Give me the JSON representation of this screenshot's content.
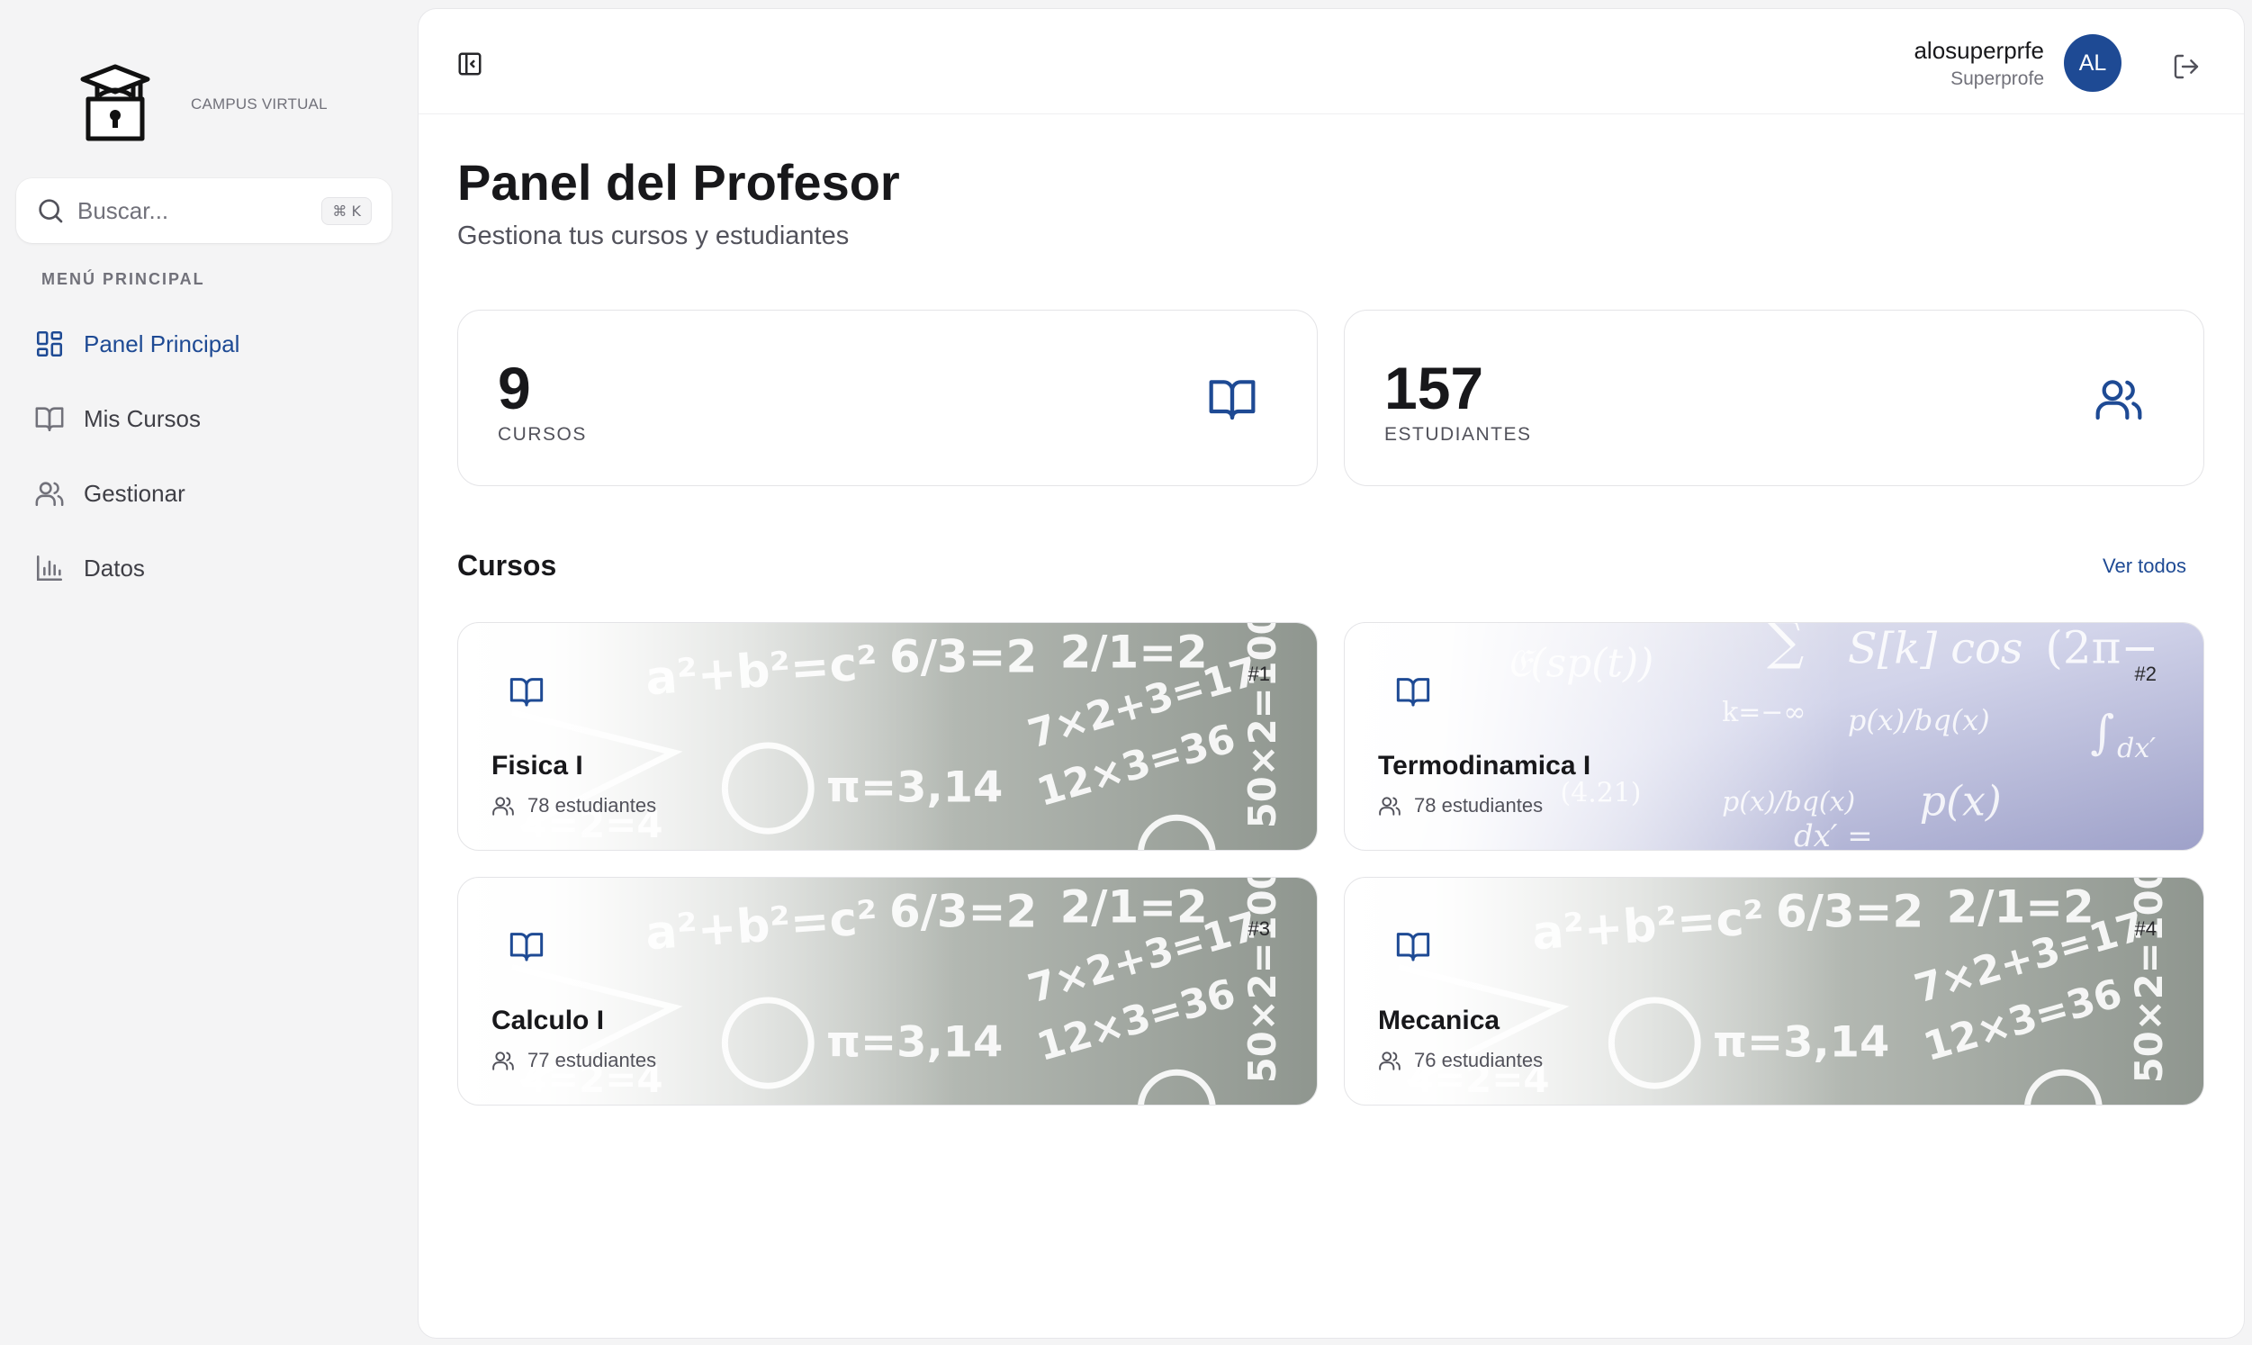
{
  "brand": {
    "name": "CAMPUS VIRTUAL",
    "logo_icon": "graduation-lock-icon"
  },
  "search": {
    "placeholder": "Buscar...",
    "shortcut": "⌘ K"
  },
  "sidebar": {
    "section_title": "MENÚ PRINCIPAL",
    "items": [
      {
        "label": "Panel Principal",
        "icon": "dashboard-icon",
        "active": true
      },
      {
        "label": "Mis Cursos",
        "icon": "book-icon",
        "active": false
      },
      {
        "label": "Gestionar",
        "icon": "users-icon",
        "active": false
      },
      {
        "label": "Datos",
        "icon": "bar-chart-icon",
        "active": false
      }
    ]
  },
  "user": {
    "name": "alosuperprfe",
    "role": "Superprofe",
    "initials": "AL"
  },
  "header": {
    "title": "Panel del Profesor",
    "subtitle": "Gestiona tus cursos y estudiantes"
  },
  "stats": [
    {
      "value": "9",
      "label": "CURSOS",
      "icon": "book-icon"
    },
    {
      "value": "157",
      "label": "ESTUDIANTES",
      "icon": "users-icon"
    }
  ],
  "courses_section": {
    "title": "Cursos",
    "see_all": "Ver todos"
  },
  "courses": [
    {
      "index": "#1",
      "title": "Fisica I",
      "students": "78 estudiantes",
      "background": "chalkboard-math"
    },
    {
      "index": "#2",
      "title": "Termodinamica I",
      "students": "78 estudiantes",
      "background": "formula-violet"
    },
    {
      "index": "#3",
      "title": "Calculo I",
      "students": "77 estudiantes",
      "background": "chalkboard-math"
    },
    {
      "index": "#4",
      "title": "Mecanica",
      "students": "76 estudiantes",
      "background": "chalkboard-math"
    }
  ],
  "colors": {
    "accent": "#1e4a94",
    "sidebar_bg": "#f4f4f5",
    "panel_bg": "#ffffff",
    "muted_text": "#71717a"
  }
}
